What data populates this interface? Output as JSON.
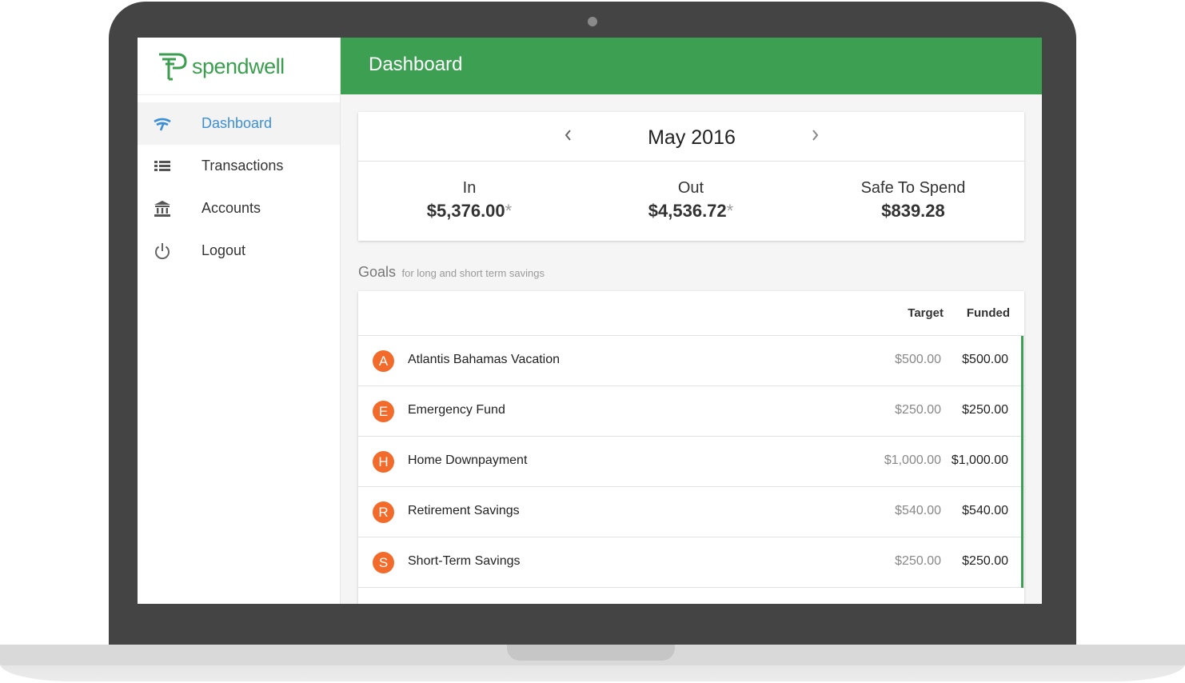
{
  "app": {
    "logo_text": "spendwell",
    "brand_color": "#3d9f52",
    "accent_color": "#3d8fd6",
    "avatar_color": "#f26b2a"
  },
  "sidebar": {
    "items": [
      {
        "label": "Dashboard",
        "icon": "dashboard-icon",
        "active": true
      },
      {
        "label": "Transactions",
        "icon": "list-icon",
        "active": false
      },
      {
        "label": "Accounts",
        "icon": "bank-icon",
        "active": false
      },
      {
        "label": "Logout",
        "icon": "power-icon",
        "active": false
      }
    ]
  },
  "header": {
    "title": "Dashboard"
  },
  "summary": {
    "month": "May 2016",
    "in_label": "In",
    "in_value": "$5,376.00",
    "out_label": "Out",
    "out_value": "$4,536.72",
    "safe_label": "Safe To Spend",
    "safe_value": "$839.28",
    "asterisk": "*"
  },
  "goals": {
    "title": "Goals",
    "subtitle": "for long and short term savings",
    "col_target": "Target",
    "col_funded": "Funded",
    "rows": [
      {
        "initial": "A",
        "name": "Atlantis Bahamas Vacation",
        "target": "$500.00",
        "funded": "$500.00"
      },
      {
        "initial": "E",
        "name": "Emergency Fund",
        "target": "$250.00",
        "funded": "$250.00"
      },
      {
        "initial": "H",
        "name": "Home Downpayment",
        "target": "$1,000.00",
        "funded": "$1,000.00"
      },
      {
        "initial": "R",
        "name": "Retirement Savings",
        "target": "$540.00",
        "funded": "$540.00"
      },
      {
        "initial": "S",
        "name": "Short-Term Savings",
        "target": "$250.00",
        "funded": "$250.00"
      }
    ]
  }
}
